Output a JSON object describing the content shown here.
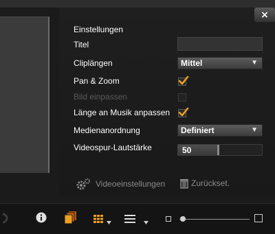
{
  "settings": {
    "heading": "Einstellungen",
    "title_label": "Titel",
    "title_value": "",
    "clip_length_label": "Cliplängen",
    "clip_length_value": "Mittel",
    "pan_zoom_label": "Pan & Zoom",
    "pan_zoom_checked": true,
    "fit_image_label": "Bild einpassen",
    "fit_image_checked": false,
    "fit_music_label": "Länge an Musik anpassen",
    "fit_music_checked": true,
    "media_order_label": "Medienanordnung",
    "media_order_value": "Definiert",
    "video_volume_label": "Videospur-Lautstärke",
    "video_volume_value": "50"
  },
  "actions": {
    "video_settings_label": "Videoeinstellungen",
    "reset_label": "Zurückset."
  },
  "close_glyph": "×",
  "zoom_level": 0.05,
  "colors": {
    "accent_orange": "#f0a020",
    "panel_bg": "#1d1d1d",
    "text": "#ffffff",
    "muted": "#8a8a8a"
  }
}
